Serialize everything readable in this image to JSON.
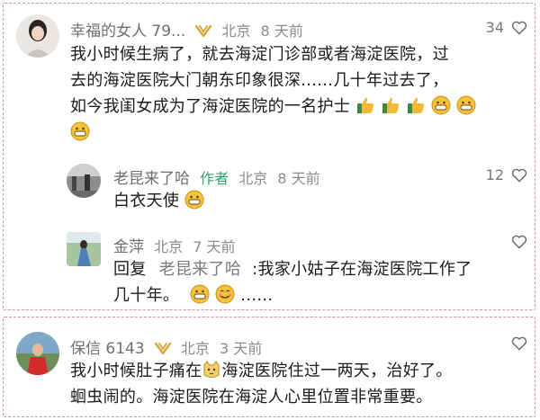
{
  "comments": [
    {
      "name": "幸福的女人 79...",
      "location": "北京",
      "time": "8 天前",
      "likes": "34",
      "text_lines": [
        "我小时候生病了，就去海淀门诊部或者海淀医院，过",
        "去的海淀医院大门朝东印象很深......几十年过去了，",
        "如今我闺女成为了海淀医院的一名护士"
      ]
    },
    {
      "name": "老昆来了哈",
      "badge": "作者",
      "location": "北京",
      "time": "8 天前",
      "likes": "12",
      "text_lines": [
        "白衣天使"
      ]
    },
    {
      "name": "金萍",
      "location": "北京",
      "time": "7 天前",
      "reply_prefix": "回复",
      "reply_to": "老昆来了哈",
      "text_lines": [
        ":我家小姑子在海淀医院工作了",
        "几十年。",
        "......"
      ]
    },
    {
      "name": "保信 6143",
      "location": "北京",
      "time": "3 天前",
      "text_lines": [
        "我小时候肚子痛在",
        "海淀医院住过一两天，治好了。",
        "蛔虫闹的。海淀医院在海淀人心里位置非常重要。"
      ]
    }
  ],
  "colors": {
    "author_badge": "#2aa86a",
    "dashed_border": "#cc9999",
    "name": "#6e6e6e"
  }
}
